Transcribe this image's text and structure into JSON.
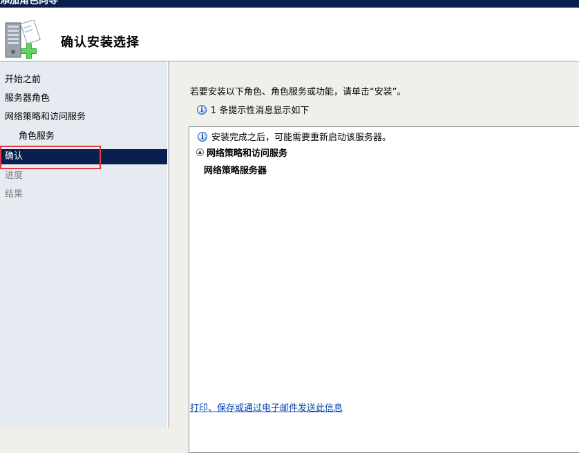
{
  "window": {
    "title": "添加角色向导"
  },
  "header": {
    "title": "确认安装选择",
    "icon": "server-add-icon"
  },
  "sidebar": {
    "items": [
      {
        "label": "开始之前",
        "state": "normal"
      },
      {
        "label": "服务器角色",
        "state": "normal"
      },
      {
        "label": "网络策略和访问服务",
        "state": "normal"
      },
      {
        "label": "角色服务",
        "state": "normal",
        "indent": true
      },
      {
        "label": "确认",
        "state": "selected"
      },
      {
        "label": "进度",
        "state": "disabled"
      },
      {
        "label": "结果",
        "state": "disabled"
      }
    ]
  },
  "main": {
    "instruction": "若要安装以下角色、角色服务或功能，请单击“安装”。",
    "info_message": "1 条提示性消息显示如下",
    "summary": {
      "restart_notice": "安装完成之后，可能需要重新启动该服务器。",
      "section_title": "网络策略和访问服务",
      "item": "网络策略服务器"
    },
    "footer_link": "打印、保存或通过电子邮件发送此信息"
  },
  "colors": {
    "title_bar": "#0a1f4e",
    "selected_bg": "#0a1f4e",
    "highlight_border": "#e0383b",
    "link": "#0645ad"
  }
}
